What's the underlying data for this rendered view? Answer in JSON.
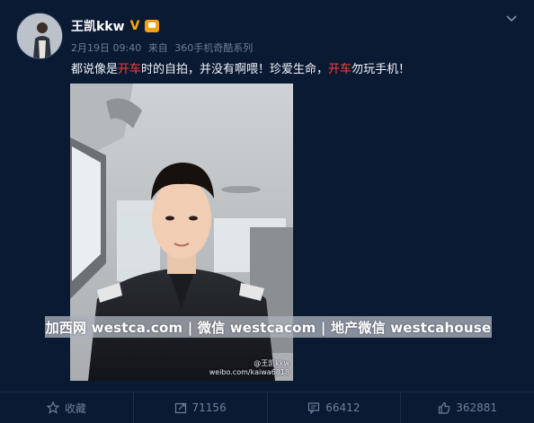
{
  "user": {
    "name": "王凯kkw",
    "verified_mark": "V",
    "member_badge_icon": "vip-member-icon"
  },
  "meta": {
    "date": "2月19日 09:40",
    "source_prefix": "来自",
    "source": "360手机奇酷系列"
  },
  "post": {
    "segments": [
      {
        "text": "都说像是",
        "highlight": false
      },
      {
        "text": "开车",
        "highlight": true
      },
      {
        "text": "时的自拍，并没有啊喂！珍爱生命，",
        "highlight": false
      },
      {
        "text": "开车",
        "highlight": true
      },
      {
        "text": "勿玩手机！",
        "highlight": false
      }
    ],
    "highlight_color": "#ff3b30"
  },
  "photo": {
    "credit_line1": "@王凯kkw",
    "credit_line2": "weibo.com/kaiwa6818"
  },
  "watermark": "加西网 westca.com | 微信 westcacom | 地产微信 westcahouse",
  "actions": [
    {
      "icon": "star-icon",
      "label": "收藏"
    },
    {
      "icon": "repost-icon",
      "label": "71156"
    },
    {
      "icon": "comment-icon",
      "label": "66412"
    },
    {
      "icon": "like-icon",
      "label": "362881"
    }
  ],
  "colors": {
    "background": "#0b1a33",
    "verified": "#f7b100",
    "muted": "#6d7d96"
  }
}
